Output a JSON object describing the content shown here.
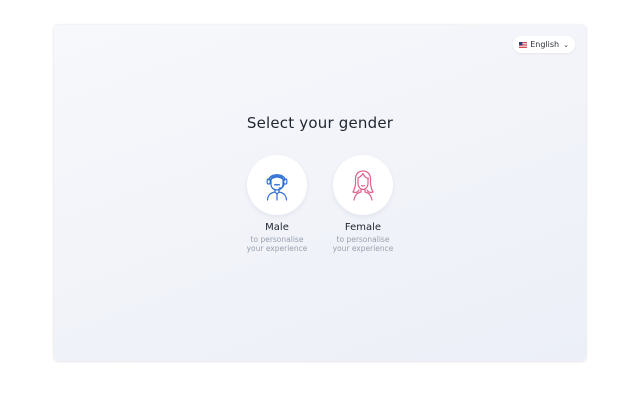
{
  "header": {
    "language_label": "English",
    "language_flag": "us-flag-icon"
  },
  "main": {
    "title": "Select your gender",
    "options": [
      {
        "label": "Male",
        "subtitle_line1": "to personalise",
        "subtitle_line2": "your experience",
        "icon": "male-avatar-icon",
        "accent": "#2f6fd8"
      },
      {
        "label": "Female",
        "subtitle_line1": "to personalise",
        "subtitle_line2": "your experience",
        "icon": "female-avatar-icon",
        "accent": "#e0608a"
      }
    ]
  }
}
